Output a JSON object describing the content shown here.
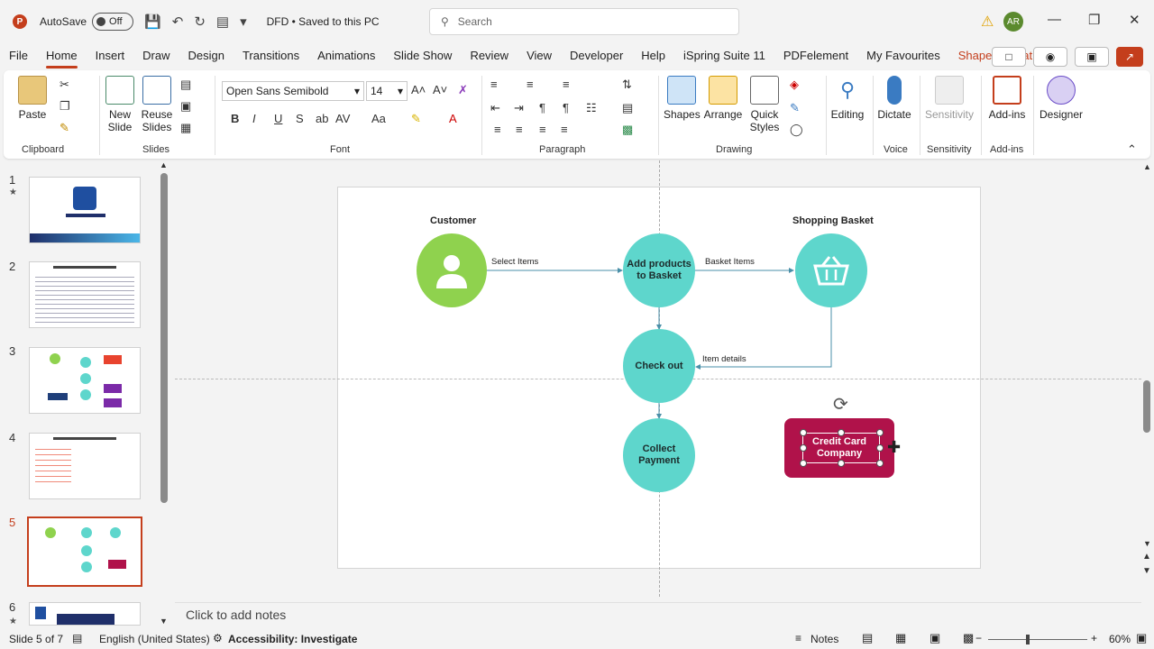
{
  "titlebar": {
    "app_logo": "P",
    "autosave_label": "AutoSave",
    "autosave_state": "Off",
    "doc_title": "DFD • Saved to this PC",
    "search_placeholder": "Search",
    "avatar_initials": "AR"
  },
  "menu": {
    "tabs": [
      "File",
      "Home",
      "Insert",
      "Draw",
      "Design",
      "Transitions",
      "Animations",
      "Slide Show",
      "Review",
      "View",
      "Developer",
      "Help",
      "iSpring Suite 11",
      "PDFelement",
      "My Favourites",
      "Shape Format"
    ],
    "active": "Home"
  },
  "ribbon": {
    "clipboard": {
      "label": "Clipboard",
      "paste": "Paste"
    },
    "slides": {
      "label": "Slides",
      "new_slide": "New Slide",
      "reuse_slides": "Reuse Slides"
    },
    "font": {
      "label": "Font",
      "font_name": "Open Sans Semibold",
      "font_size": "14",
      "bold": "B",
      "italic": "I",
      "underline": "U",
      "strike": "S"
    },
    "paragraph": {
      "label": "Paragraph"
    },
    "drawing": {
      "label": "Drawing",
      "shapes": "Shapes",
      "arrange": "Arrange",
      "quick_styles": "Quick Styles"
    },
    "editing": {
      "label": "Editing"
    },
    "voice": {
      "label": "Voice",
      "dictate": "Dictate"
    },
    "sensitivity": {
      "label": "Sensitivity",
      "button": "Sensitivity"
    },
    "addins": {
      "label": "Add-ins",
      "button": "Add-ins"
    },
    "designer": {
      "button": "Designer"
    }
  },
  "thumbnails": [
    {
      "num": "1",
      "starred": true
    },
    {
      "num": "2",
      "starred": false
    },
    {
      "num": "3",
      "starred": false
    },
    {
      "num": "4",
      "starred": false
    },
    {
      "num": "5",
      "starred": false,
      "selected": true
    },
    {
      "num": "6",
      "starred": true
    }
  ],
  "slide": {
    "customer_label": "Customer",
    "basket_label": "Shopping Basket",
    "add_products": "Add products to Basket",
    "check_out": "Check out",
    "collect_payment": "Collect Payment",
    "credit_card": "Credit Card Company",
    "edge_select_items": "Select Items",
    "edge_basket_items": "Basket Items",
    "edge_item_details": "Item details"
  },
  "colors": {
    "teal": "#5ed6cc",
    "green": "#8fd24e",
    "credit": "#b0124a",
    "accent": "#c43e1c"
  },
  "notes_placeholder": "Click to add notes",
  "status": {
    "slide_info": "Slide 5 of 7",
    "language": "English (United States)",
    "accessibility": "Accessibility: Investigate",
    "notes_btn": "Notes",
    "zoom": "60%"
  }
}
